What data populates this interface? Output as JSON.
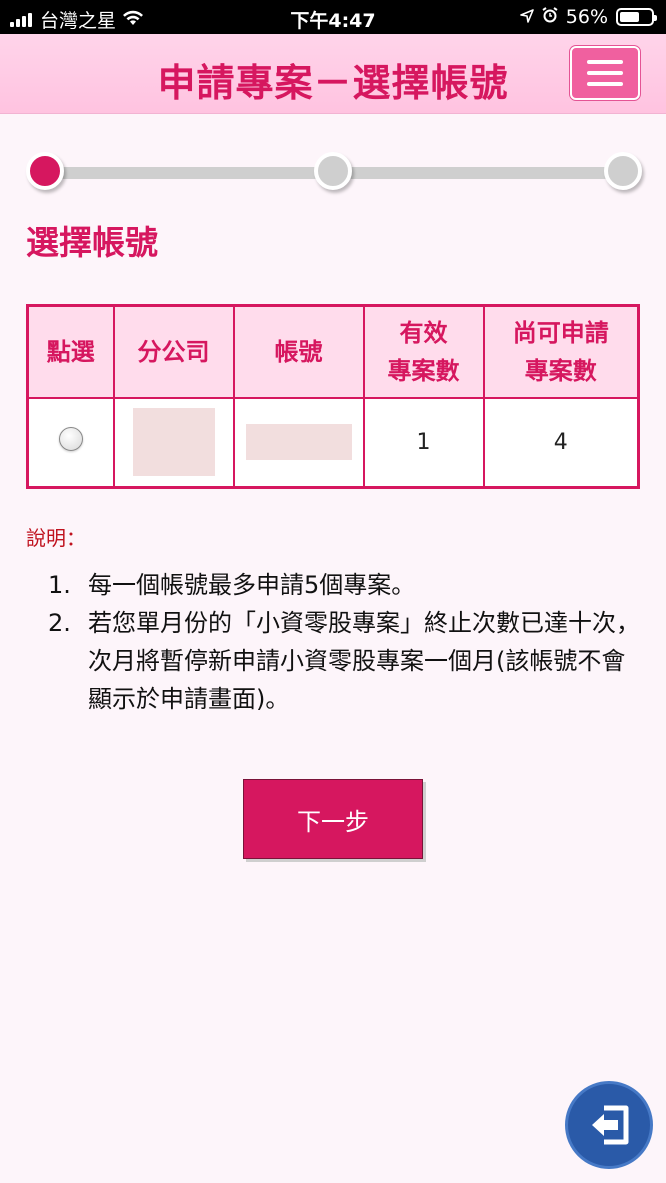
{
  "status_bar": {
    "carrier": "台灣之星",
    "time": "下午4:47",
    "battery_percent": "56%",
    "battery_level": 0.56,
    "icons": [
      "signal-icon",
      "wifi-icon",
      "location-icon",
      "alarm-icon",
      "battery-icon"
    ]
  },
  "header": {
    "title": "申請專案－選擇帳號",
    "menu_icon": "hamburger-icon"
  },
  "progress": {
    "steps_total": 3,
    "current_step": 1
  },
  "section": {
    "title": "選擇帳號"
  },
  "table": {
    "headers": {
      "select": "點選",
      "branch": "分公司",
      "account": "帳號",
      "valid_line1": "有效",
      "valid_line2": "專案數",
      "avail_line1": "尚可申請",
      "avail_line2": "專案數"
    },
    "rows": [
      {
        "selected": false,
        "branch": "",
        "account": "",
        "valid": "1",
        "available": "4"
      }
    ]
  },
  "notes": {
    "label": "說明：",
    "items": [
      {
        "num": "1.",
        "text": "每一個帳號最多申請5個專案。"
      },
      {
        "num": "2.",
        "text": "若您單月份的「小資零股專案」終止次數已達十次，次月將暫停新申請小資零股專案一個月(該帳號不會顯示於申請畫面)。"
      }
    ]
  },
  "actions": {
    "next_label": "下一步",
    "exit_icon": "exit-icon"
  },
  "colors": {
    "accent": "#d6175f",
    "header_bg": "#ffc9e4",
    "exit_button": "#2a5aa8"
  }
}
